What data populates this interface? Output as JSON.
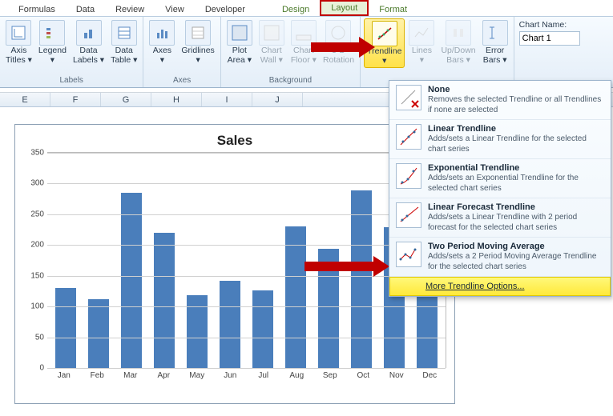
{
  "tabs": {
    "formulas": "Formulas",
    "data": "Data",
    "review": "Review",
    "view": "View",
    "developer": "Developer",
    "design": "Design",
    "layout": "Layout",
    "format": "Format"
  },
  "ribbon": {
    "labels": {
      "axisTitles": "Axis\nTitles ▾",
      "legend": "Legend\n▾",
      "dataLabels": "Data\nLabels ▾",
      "dataTable": "Data\nTable ▾",
      "axes": "Axes\n▾",
      "gridlines": "Gridlines\n▾",
      "plotArea": "Plot\nArea ▾",
      "chartWall": "Chart\nWall ▾",
      "chartFloor": "Chart\nFloor ▾",
      "rotation": "3-D\nRotation",
      "trendline": "Trendline\n▾",
      "lines": "Lines\n▾",
      "updown": "Up/Down\nBars ▾",
      "errorBars": "Error\nBars ▾"
    },
    "groups": {
      "labels": "Labels",
      "axes": "Axes",
      "background": "Background"
    },
    "chartNameLabel": "Chart Name:",
    "chartNameValue": "Chart 1"
  },
  "cols": [
    "E",
    "F",
    "G",
    "H",
    "I",
    "J"
  ],
  "chart_data": {
    "type": "bar",
    "title": "Sales",
    "xlabel": "",
    "ylabel": "",
    "ylim": [
      0,
      350
    ],
    "yticks": [
      0,
      50,
      100,
      150,
      200,
      250,
      300,
      350
    ],
    "categories": [
      "Jan",
      "Feb",
      "Mar",
      "Apr",
      "May",
      "Jun",
      "Jul",
      "Aug",
      "Sep",
      "Oct",
      "Nov",
      "Dec"
    ],
    "values": [
      130,
      112,
      285,
      220,
      118,
      142,
      126,
      230,
      194,
      289,
      229,
      175
    ]
  },
  "dropdown": {
    "items": [
      {
        "title": "None",
        "desc": "Removes the selected Trendline or all Trendlines if none are selected"
      },
      {
        "title": "Linear Trendline",
        "desc": "Adds/sets a Linear Trendline for the selected chart series"
      },
      {
        "title": "Exponential Trendline",
        "desc": "Adds/sets an Exponential Trendline for the selected chart series"
      },
      {
        "title": "Linear Forecast Trendline",
        "desc": "Adds/sets a Linear Trendline with 2 period forecast for the selected chart series"
      },
      {
        "title": "Two Period Moving Average",
        "desc": "Adds/sets a 2 Period Moving Average Trendline for the selected chart series"
      }
    ],
    "more": "More Trendline Options..."
  }
}
